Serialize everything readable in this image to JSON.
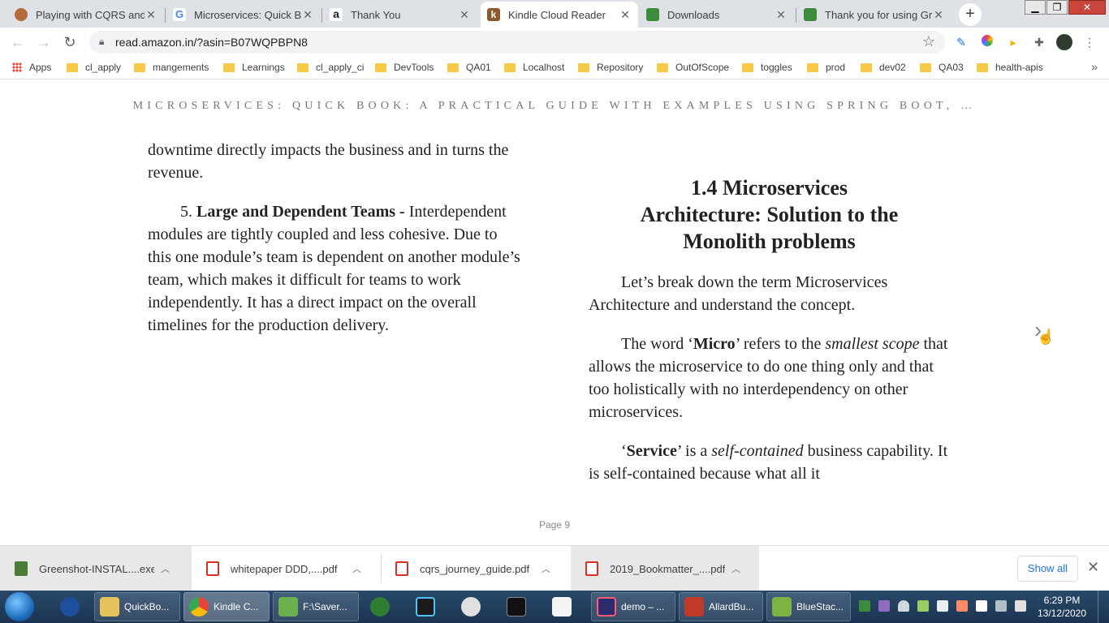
{
  "browser": {
    "tabs": [
      {
        "title": "Playing with CQRS and E",
        "favicon_color": "#b56b3e"
      },
      {
        "title": "Microservices: Quick Boo",
        "favicon_color": "#4285f4"
      },
      {
        "title": "Thank You",
        "favicon_color": "#222222"
      },
      {
        "title": "Kindle Cloud Reader",
        "favicon_color": "#8b5a2b"
      },
      {
        "title": "Downloads",
        "favicon_color": "#3c8c3c"
      },
      {
        "title": "Thank you for using Gre",
        "favicon_color": "#3c8c3c"
      }
    ],
    "url": "read.amazon.in/?asin=B07WQPBPN8"
  },
  "bookmarks": [
    {
      "label": "Apps",
      "icon": "apps-grid-icon"
    },
    {
      "label": "cl_apply",
      "icon": "folder-icon"
    },
    {
      "label": "mangements",
      "icon": "folder-icon"
    },
    {
      "label": "Learnings",
      "icon": "folder-icon"
    },
    {
      "label": "cl_apply_ci",
      "icon": "folder-icon"
    },
    {
      "label": "DevTools",
      "icon": "folder-icon"
    },
    {
      "label": "QA01",
      "icon": "folder-icon"
    },
    {
      "label": "Localhost",
      "icon": "folder-icon"
    },
    {
      "label": "Repository",
      "icon": "folder-icon"
    },
    {
      "label": "OutOfScope",
      "icon": "folder-icon"
    },
    {
      "label": "toggles",
      "icon": "folder-icon"
    },
    {
      "label": "prod",
      "icon": "folder-icon"
    },
    {
      "label": "dev02",
      "icon": "folder-icon"
    },
    {
      "label": "QA03",
      "icon": "folder-icon"
    },
    {
      "label": "health-apis",
      "icon": "folder-icon"
    }
  ],
  "reader": {
    "book_title": "MICROSERVICES: QUICK BOOK: A PRACTICAL GUIDE WITH EXAMPLES USING SPRING BOOT, …",
    "left": {
      "para1": "downtime directly impacts the business and in turns the revenue.",
      "item_number": "5.",
      "item_heading": "Large and Dependent Teams -",
      "item_body": "Interdependent modules are tightly coupled and less cohesive. Due to this one module’s team is dependent on another module’s team, which makes it difficult for teams to work independently. It has a direct impact on the overall timelines for the production delivery."
    },
    "right": {
      "heading_line1": "1.4 Microservices",
      "heading_line2": "Architecture: Solution to the",
      "heading_line3": "Monolith problems",
      "para1": "Let’s break down the term Microservices Architecture and understand the concept.",
      "para2_pre": "The word ‘",
      "para2_bold": "Micro",
      "para2_mid": "’ refers to the ",
      "para2_italic": "smallest scope",
      "para2_post": " that allows the microservice to do one thing only and that too holistically with no interdependency on other microservices.",
      "para3_pre": "‘",
      "para3_bold": "Service",
      "para3_mid": "’ is a ",
      "para3_italic": "self-contained",
      "para3_post": " business capability. It is self-contained because what all it"
    },
    "page_label": "Page 9"
  },
  "downloads": {
    "items": [
      {
        "name": "Greenshot-INSTAL....exe",
        "icon_color": "#4a7c3a"
      },
      {
        "name": "whitepaper DDD,....pdf",
        "icon_color": "#d93025"
      },
      {
        "name": "cqrs_journey_guide.pdf",
        "icon_color": "#d93025"
      },
      {
        "name": "2019_Bookmatter_....pdf",
        "icon_color": "#d93025"
      }
    ],
    "show_all": "Show all"
  },
  "taskbar": {
    "items": [
      {
        "label": "QuickBo...",
        "icon_color": "#e8c25a"
      },
      {
        "label": "Kindle C...",
        "icon_color": "#4285f4"
      },
      {
        "label": "F:\\Saver...",
        "icon_color": "#6ab04c"
      },
      {
        "label": "demo – ...",
        "icon_color": "#2b2b6e"
      },
      {
        "label": "AllardBu...",
        "icon_color": "#c0392b"
      },
      {
        "label": "BlueStac...",
        "icon_color": "#7cb342"
      }
    ],
    "time": "6:29 PM",
    "date": "13/12/2020"
  }
}
